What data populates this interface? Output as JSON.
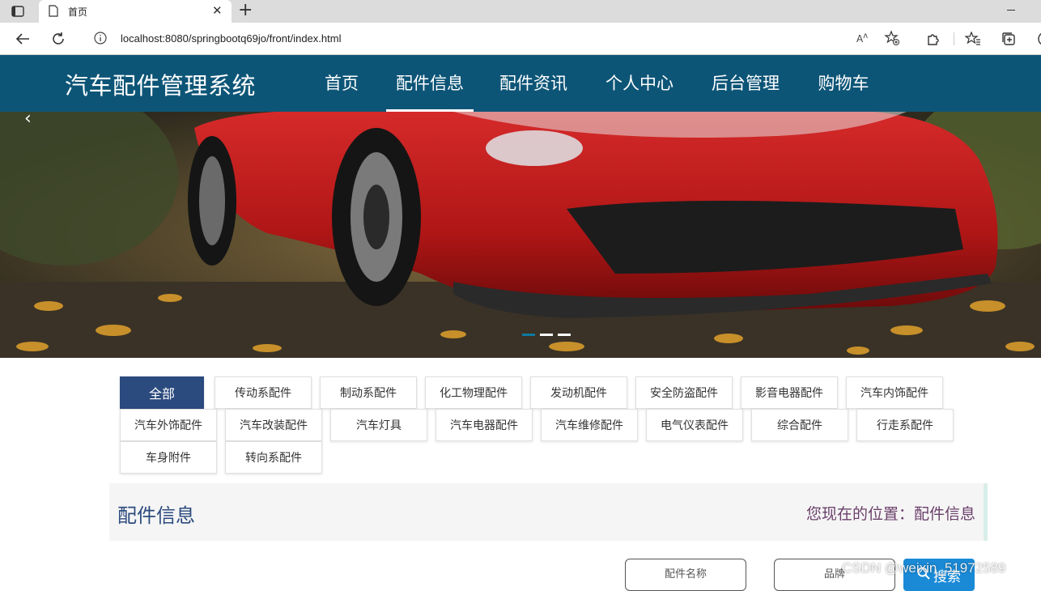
{
  "browser": {
    "tab_title": "首页",
    "url": "localhost:8080/springbootq69jo/front/index.html",
    "read_aloud_label": "A̅"
  },
  "site": {
    "title": "汽车配件管理系统",
    "nav": [
      {
        "label": "首页"
      },
      {
        "label": "配件信息"
      },
      {
        "label": "配件资讯"
      },
      {
        "label": "个人中心"
      },
      {
        "label": "后台管理"
      },
      {
        "label": "购物车"
      }
    ],
    "active_nav": "配件信息"
  },
  "banner": {
    "slide_count": 3,
    "active_slide": 1
  },
  "categories": [
    "全部",
    "传动系配件",
    "制动系配件",
    "化工物理配件",
    "发动机配件",
    "安全防盗配件",
    "影音电器配件",
    "汽车内饰配件",
    "汽车外饰配件",
    "汽车改装配件",
    "汽车灯具",
    "汽车电器配件",
    "汽车维修配件",
    "电气仪表配件",
    "综合配件",
    "行走系配件",
    "车身附件",
    "转向系配件"
  ],
  "active_category": "全部",
  "section": {
    "title": "配件信息",
    "breadcrumb_prefix": "您现在的位置：",
    "breadcrumb_current": "配件信息"
  },
  "search": {
    "name_placeholder": "配件名称",
    "brand_placeholder": "品牌",
    "button_label": "搜索"
  },
  "watermark": "CSDN @weixin_51972589",
  "colors": {
    "header_bg": "#0d5577",
    "active_category_bg": "#2b4a7e",
    "search_button_bg": "#1a8ad6"
  }
}
